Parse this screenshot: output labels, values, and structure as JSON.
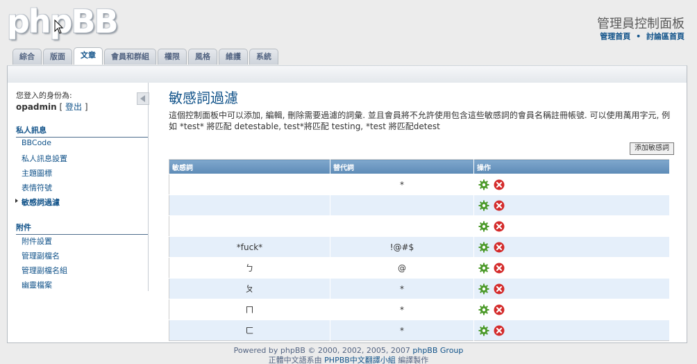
{
  "logo": "phpBB",
  "header": {
    "title": "管理員控制面板",
    "links": [
      "管理首頁",
      "討論區首頁"
    ],
    "separator": "•"
  },
  "tabs": [
    {
      "label": "綜合",
      "active": false
    },
    {
      "label": "版面",
      "active": false
    },
    {
      "label": "文章",
      "active": true
    },
    {
      "label": "會員和群組",
      "active": false
    },
    {
      "label": "權限",
      "active": false
    },
    {
      "label": "風格",
      "active": false
    },
    {
      "label": "維護",
      "active": false
    },
    {
      "label": "系統",
      "active": false
    }
  ],
  "sidebar": {
    "logged_in_label": "您登入的身份為:",
    "username": "opadmin",
    "logout_open": "[",
    "logout_label": "登出",
    "logout_close": "]",
    "sections": [
      {
        "title": "私人訊息",
        "items": [
          {
            "label": "BBCode",
            "active": false
          },
          {
            "label": "私人訊息設置",
            "active": false
          },
          {
            "label": "主題圖標",
            "active": false
          },
          {
            "label": "表情符號",
            "active": false
          },
          {
            "label": "敏感詞過濾",
            "active": true
          }
        ]
      },
      {
        "title": "附件",
        "items": [
          {
            "label": "附件設置",
            "active": false
          },
          {
            "label": "管理副檔名",
            "active": false
          },
          {
            "label": "管理副檔名組",
            "active": false
          },
          {
            "label": "幽靈檔案",
            "active": false
          }
        ]
      }
    ]
  },
  "main": {
    "title": "敏感詞過濾",
    "description": "這個控制面板中可以添加, 編輯, 刪除需要過濾的詞彙. 並且會員將不允許使用包含這些敏感詞的會員名稱註冊帳號. 可以使用萬用字元, 例如 *test* 將匹配 detestable, test*將匹配 testing, *test 將匹配detest",
    "add_button": "添加敏感詞",
    "table": {
      "headers": [
        "敏感詞",
        "替代詞",
        "操作"
      ],
      "rows": [
        {
          "word": "",
          "replacement": "*"
        },
        {
          "word": "",
          "replacement": ""
        },
        {
          "word": "",
          "replacement": ""
        },
        {
          "word": "*fuck*",
          "replacement": "!@#$"
        },
        {
          "word": "ㄅ",
          "replacement": "@"
        },
        {
          "word": "ㄆ",
          "replacement": "*"
        },
        {
          "word": "ㄇ",
          "replacement": "*"
        },
        {
          "word": "ㄈ",
          "replacement": "*"
        }
      ]
    }
  },
  "footer": {
    "line1_prefix": "Powered by phpBB © 2000, 2002, 2005, 2007",
    "line1_link": "phpBB Group",
    "line2_prefix": "正體中文語系由",
    "line2_link": "PHPBB中文翻譯小組",
    "line2_suffix": "編譯製作"
  },
  "colors": {
    "accent": "#105289",
    "table_header": "#6f9cc6",
    "row_alt": "#e5effa",
    "edit_icon": "#4c9a2a",
    "delete_icon": "#d42c2c"
  },
  "icons": {
    "edit": "gear-icon",
    "delete": "delete-icon",
    "collapse": "collapse-arrow-icon",
    "cursor": "mouse-cursor-icon"
  }
}
